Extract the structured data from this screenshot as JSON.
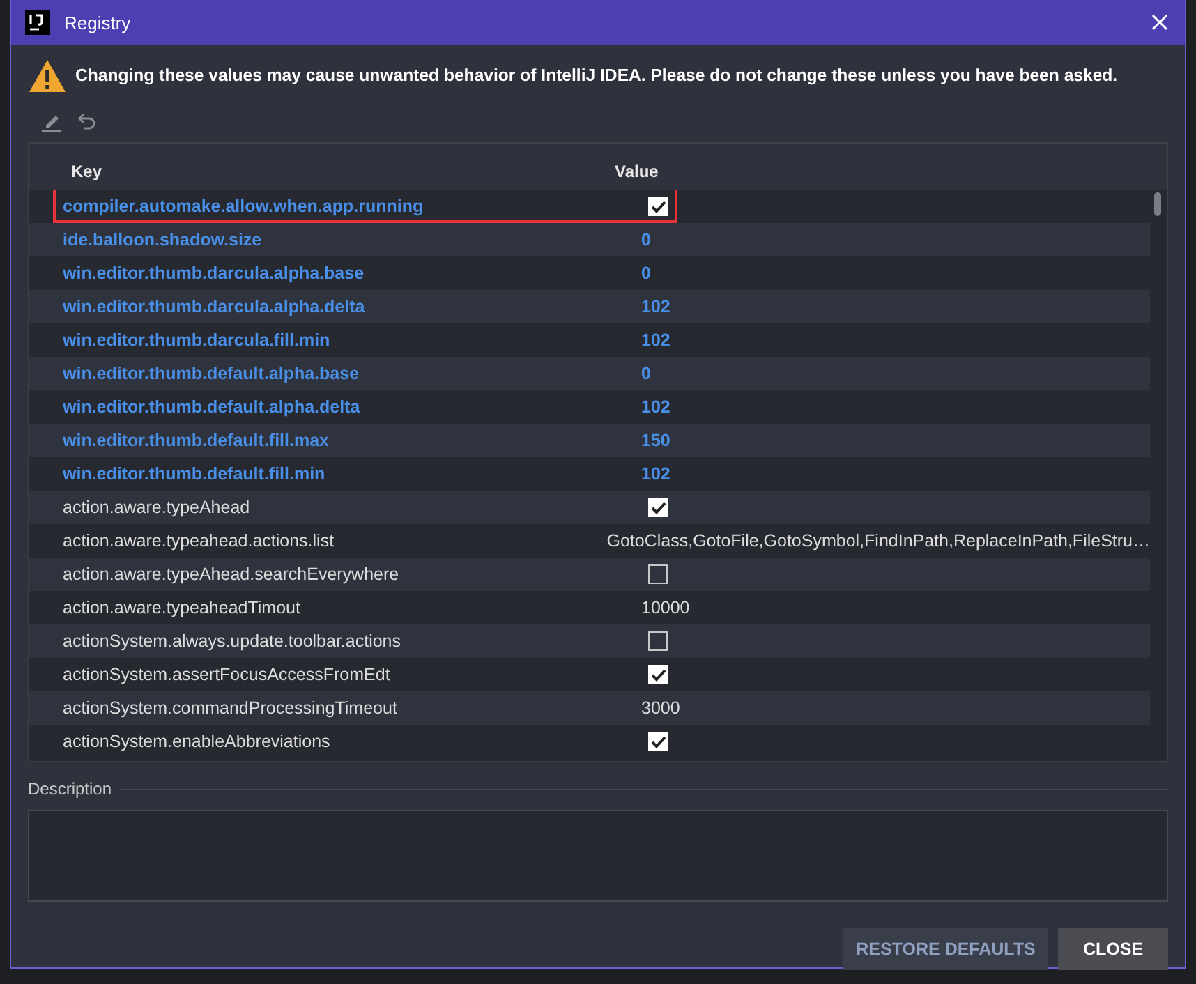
{
  "window": {
    "title": "Registry"
  },
  "warning": {
    "text": "Changing these values may cause unwanted behavior of IntelliJ IDEA. Please do not change these unless you have been asked."
  },
  "table": {
    "columns": [
      "Key",
      "Value"
    ],
    "rows": [
      {
        "key": "compiler.automake.allow.when.app.running",
        "kind": "checkbox",
        "checked": true,
        "modified": true,
        "highlighted": true
      },
      {
        "key": "ide.balloon.shadow.size",
        "kind": "text",
        "value": "0",
        "modified": true,
        "highlighted": false
      },
      {
        "key": "win.editor.thumb.darcula.alpha.base",
        "kind": "text",
        "value": "0",
        "modified": true,
        "highlighted": false
      },
      {
        "key": "win.editor.thumb.darcula.alpha.delta",
        "kind": "text",
        "value": "102",
        "modified": true,
        "highlighted": false
      },
      {
        "key": "win.editor.thumb.darcula.fill.min",
        "kind": "text",
        "value": "102",
        "modified": true,
        "highlighted": false
      },
      {
        "key": "win.editor.thumb.default.alpha.base",
        "kind": "text",
        "value": "0",
        "modified": true,
        "highlighted": false
      },
      {
        "key": "win.editor.thumb.default.alpha.delta",
        "kind": "text",
        "value": "102",
        "modified": true,
        "highlighted": false
      },
      {
        "key": "win.editor.thumb.default.fill.max",
        "kind": "text",
        "value": "150",
        "modified": true,
        "highlighted": false
      },
      {
        "key": "win.editor.thumb.default.fill.min",
        "kind": "text",
        "value": "102",
        "modified": true,
        "highlighted": false
      },
      {
        "key": "action.aware.typeAhead",
        "kind": "checkbox",
        "checked": true,
        "modified": false,
        "highlighted": false
      },
      {
        "key": "action.aware.typeahead.actions.list",
        "kind": "text",
        "value": "GotoClass,GotoFile,GotoSymbol,FindInPath,ReplaceInPath,FileStru…",
        "modified": false,
        "highlighted": false
      },
      {
        "key": "action.aware.typeAhead.searchEverywhere",
        "kind": "checkbox",
        "checked": false,
        "modified": false,
        "highlighted": false
      },
      {
        "key": "action.aware.typeaheadTimout",
        "kind": "text",
        "value": "10000",
        "modified": false,
        "highlighted": false
      },
      {
        "key": "actionSystem.always.update.toolbar.actions",
        "kind": "checkbox",
        "checked": false,
        "modified": false,
        "highlighted": false
      },
      {
        "key": "actionSystem.assertFocusAccessFromEdt",
        "kind": "checkbox",
        "checked": true,
        "modified": false,
        "highlighted": false
      },
      {
        "key": "actionSystem.commandProcessingTimeout",
        "kind": "text",
        "value": "3000",
        "modified": false,
        "highlighted": false
      },
      {
        "key": "actionSystem.enableAbbreviations",
        "kind": "checkbox",
        "checked": true,
        "modified": false,
        "highlighted": false
      }
    ]
  },
  "description": {
    "label": "Description"
  },
  "buttons": [
    {
      "label": "RESTORE DEFAULTS",
      "kind": "secondary"
    },
    {
      "label": "CLOSE",
      "kind": "primary"
    }
  ]
}
